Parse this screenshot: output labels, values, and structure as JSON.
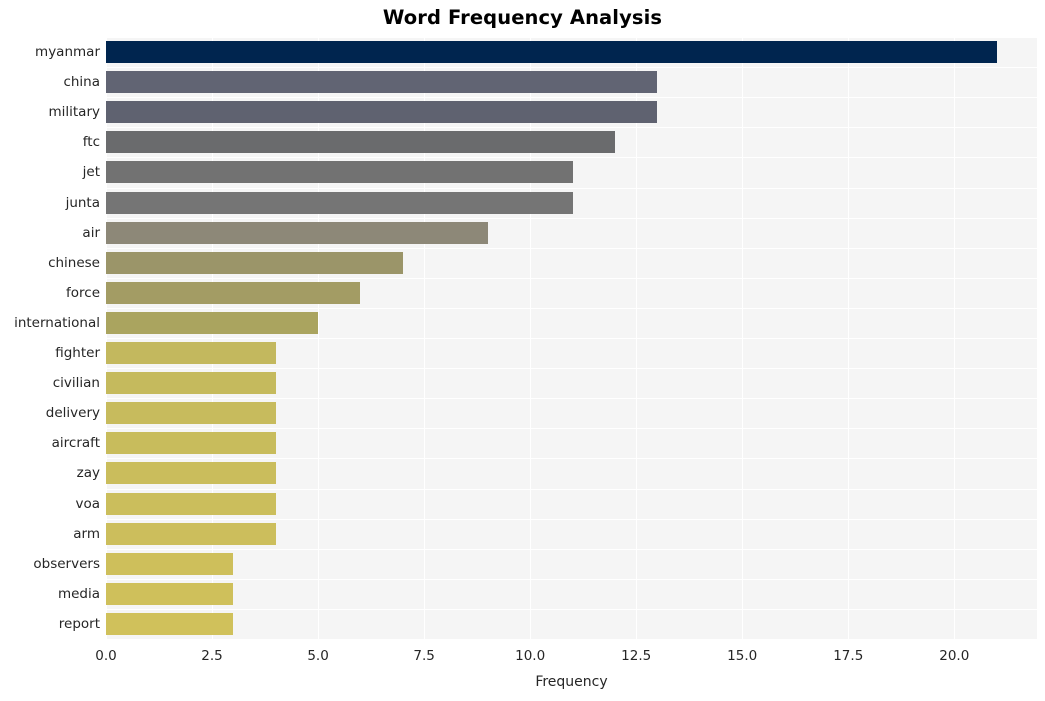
{
  "chart_data": {
    "type": "bar",
    "orientation": "horizontal",
    "title": "Word Frequency Analysis",
    "xlabel": "Frequency",
    "ylabel": "",
    "categories": [
      "myanmar",
      "china",
      "military",
      "ftc",
      "jet",
      "junta",
      "air",
      "chinese",
      "force",
      "international",
      "fighter",
      "civilian",
      "delivery",
      "aircraft",
      "zay",
      "voa",
      "arm",
      "observers",
      "media",
      "report"
    ],
    "values": [
      21,
      13,
      13,
      12,
      11,
      11,
      9,
      7,
      6,
      5,
      4,
      4,
      4,
      4,
      4,
      4,
      4,
      3,
      3,
      3
    ],
    "bar_colors": [
      "#00254f",
      "#616473",
      "#5f6270",
      "#6a6b6d",
      "#727272",
      "#757575",
      "#8d8878",
      "#9b9569",
      "#a39c64",
      "#aaa45f",
      "#c3b85e",
      "#c5ba5d",
      "#c7bb5d",
      "#c8bc5c",
      "#cabd5c",
      "#cbbe5c",
      "#ccbe5c",
      "#cebf5b",
      "#cfc05b",
      "#d0c15b"
    ],
    "xticks": [
      "0.0",
      "2.5",
      "5.0",
      "7.5",
      "10.0",
      "12.5",
      "15.0",
      "17.5",
      "20.0"
    ],
    "xtick_values": [
      0,
      2.5,
      5,
      7.5,
      10,
      12.5,
      15,
      17.5,
      20
    ],
    "xlim": [
      0,
      21.95
    ],
    "grid": true,
    "legend": "none",
    "plot_background": "#f5f5f5",
    "figure_background": "#ffffff"
  }
}
